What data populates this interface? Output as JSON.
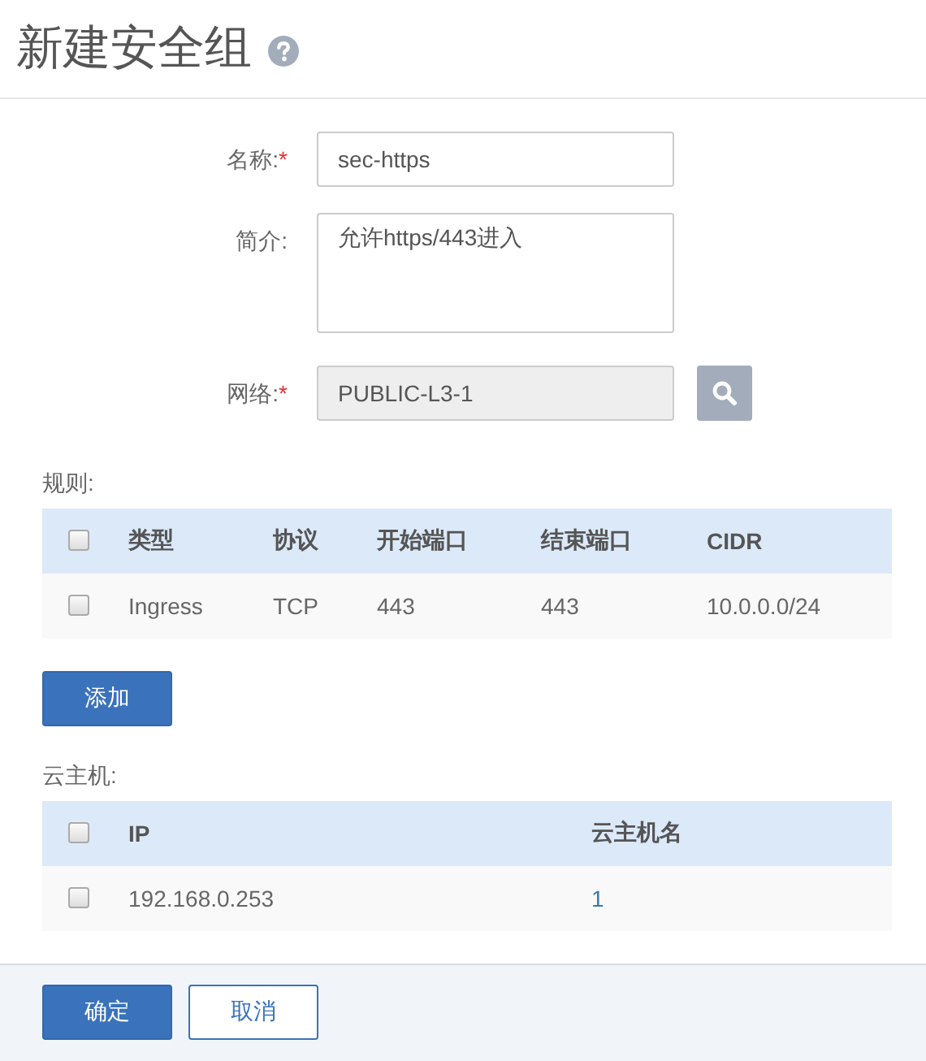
{
  "title": "新建安全组",
  "form": [
    {
      "kind": "input",
      "label": "名称:",
      "required_mark": "*",
      "value": "sec-https"
    },
    {
      "kind": "textarea",
      "label": "简介:",
      "value": "允许https/443进入"
    },
    {
      "kind": "search",
      "label": "网络:",
      "required_mark": "*",
      "value": "PUBLIC-L3-1"
    }
  ],
  "rules": {
    "label": "规则:",
    "header_checked": false,
    "columns": [
      "类型",
      "协议",
      "开始端口",
      "结束端口",
      "CIDR"
    ],
    "rows": [
      {
        "checked": false,
        "cells": [
          "Ingress",
          "TCP",
          "443",
          "443",
          "10.0.0.0/24"
        ]
      }
    ]
  },
  "add_button": "添加",
  "vms": {
    "label": "云主机:",
    "header_checked": false,
    "columns": [
      "IP",
      "云主机名"
    ],
    "rows": [
      {
        "checked": false,
        "ip": "192.168.0.253",
        "name": "1"
      }
    ]
  },
  "buttons": [
    {
      "kind": "primary",
      "label": "确定"
    },
    {
      "kind": "secondary",
      "label": "取消"
    }
  ]
}
